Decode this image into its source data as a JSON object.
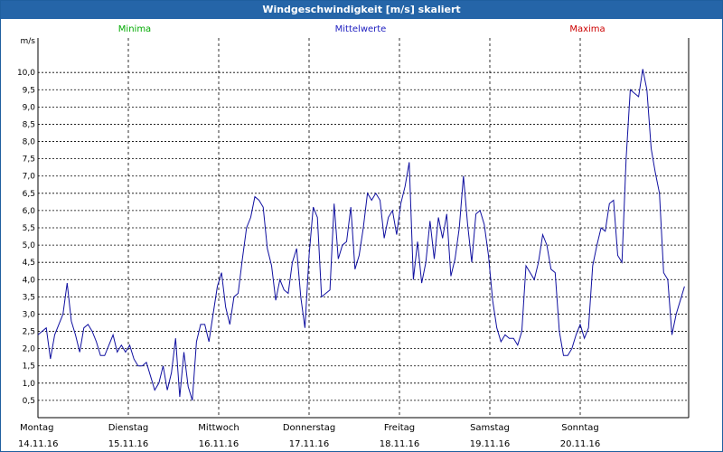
{
  "window": {
    "title": "Windgeschwindigkeit [m/s] skaliert"
  },
  "legend": [
    {
      "label": "Minima",
      "color": "#00aa00"
    },
    {
      "label": "Mittelwerte",
      "color": "#2020c0"
    },
    {
      "label": "Maxima",
      "color": "#cc0000"
    }
  ],
  "colors": {
    "series": "#1010a0",
    "grid": "#000000",
    "titlebar": "#2565a8"
  },
  "chart_data": {
    "type": "line",
    "title": "Windgeschwindigkeit [m/s] skaliert",
    "ylabel": "m/s",
    "xlabel": "",
    "ylim": [
      0,
      11
    ],
    "yticks": [
      "0,5",
      "1,0",
      "1,5",
      "2,0",
      "2,5",
      "3,0",
      "3,5",
      "4,0",
      "4,5",
      "5,0",
      "5,5",
      "6,0",
      "6,5",
      "7,0",
      "7,5",
      "8,0",
      "8,5",
      "9,0",
      "9,5",
      "10,0"
    ],
    "ytick_values": [
      0.5,
      1.0,
      1.5,
      2.0,
      2.5,
      3.0,
      3.5,
      4.0,
      4.5,
      5.0,
      5.5,
      6.0,
      6.5,
      7.0,
      7.5,
      8.0,
      8.5,
      9.0,
      9.5,
      10.0
    ],
    "x_range_days": [
      0,
      7.2
    ],
    "days": [
      {
        "name": "Montag",
        "date": "14.11.16"
      },
      {
        "name": "Dienstag",
        "date": "15.11.16"
      },
      {
        "name": "Mittwoch",
        "date": "16.11.16"
      },
      {
        "name": "Donnerstag",
        "date": "17.11.16"
      },
      {
        "name": "Freitag",
        "date": "18.11.16"
      },
      {
        "name": "Samstag",
        "date": "19.11.16"
      },
      {
        "name": "Sonntag",
        "date": "20.11.16"
      }
    ],
    "grid": true,
    "series": [
      {
        "values": [
          2.4,
          2.5,
          2.6,
          1.7,
          2.4,
          2.7,
          3.0,
          3.9,
          2.8,
          2.4,
          1.9,
          2.6,
          2.7,
          2.5,
          2.2,
          1.8,
          1.8,
          2.1,
          2.4,
          1.9,
          2.1,
          1.9,
          2.1,
          1.7,
          1.5,
          1.5,
          1.6,
          1.2,
          0.8,
          1.0,
          1.5,
          0.8,
          1.3,
          2.3,
          0.6,
          1.9,
          0.9,
          0.5,
          2.2,
          2.7,
          2.7,
          2.2,
          3.0,
          3.8,
          4.2,
          3.2,
          2.7,
          3.5,
          3.6,
          4.6,
          5.5,
          5.8,
          6.4,
          6.3,
          6.1,
          4.9,
          4.4,
          3.4,
          4.0,
          3.7,
          3.6,
          4.5,
          4.9,
          3.5,
          2.6,
          4.7,
          6.1,
          5.8,
          3.5,
          3.6,
          3.7,
          6.2,
          4.6,
          5.0,
          5.1,
          6.1,
          4.3,
          4.7,
          5.5,
          6.5,
          6.3,
          6.5,
          6.3,
          5.2,
          5.8,
          6.0,
          5.3,
          6.2,
          6.7,
          7.4,
          4.0,
          5.1,
          3.9,
          4.5,
          5.7,
          4.6,
          5.8,
          5.2,
          5.9,
          4.1,
          4.6,
          5.5,
          7.0,
          5.6,
          4.5,
          5.9,
          6.0,
          5.6,
          4.7,
          3.4,
          2.6,
          2.2,
          2.4,
          2.3,
          2.3,
          2.1,
          2.5,
          4.4,
          4.2,
          4.0,
          4.5,
          5.3,
          5.0,
          4.3,
          4.2,
          2.5,
          1.8,
          1.8,
          2.0,
          2.4,
          2.7,
          2.3,
          2.6,
          4.4,
          5.0,
          5.5,
          5.4,
          6.2,
          6.3,
          4.7,
          4.5,
          7.5,
          9.5,
          9.4,
          9.3,
          10.1,
          9.5,
          7.8,
          7.1,
          6.5,
          4.2,
          4.0,
          2.4,
          3.0,
          3.4,
          3.8
        ]
      }
    ]
  }
}
